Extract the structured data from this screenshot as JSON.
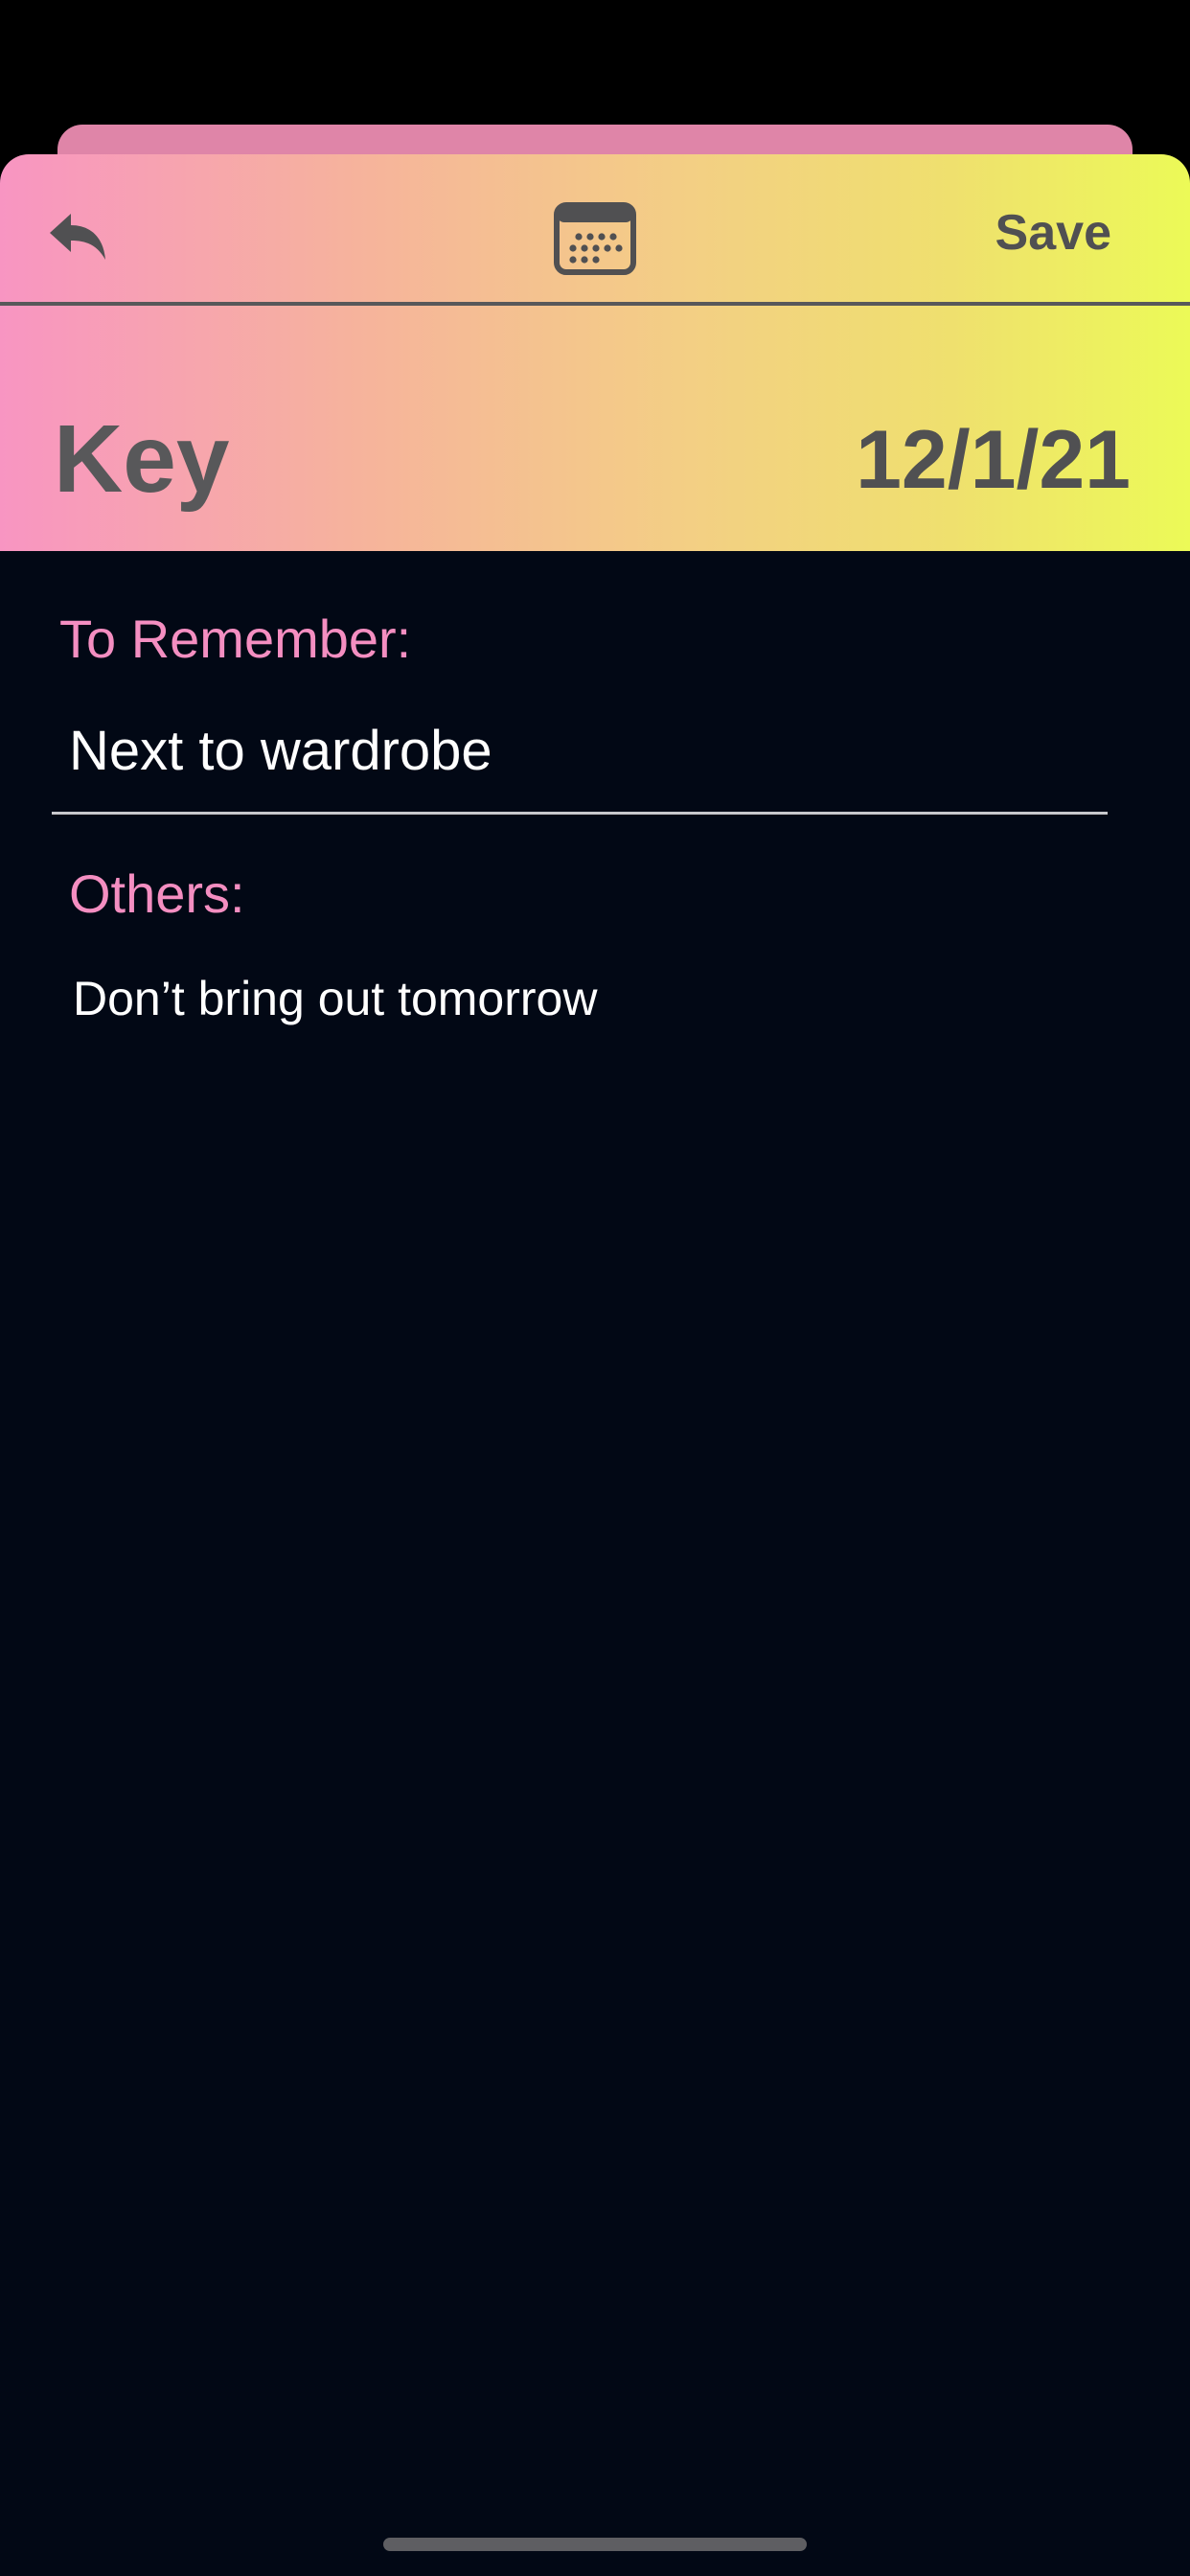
{
  "toolbar": {
    "back_icon": "reply-arrow-icon",
    "calendar_icon": "calendar-icon",
    "save_label": "Save"
  },
  "note": {
    "title": "Key",
    "date": "12/1/21"
  },
  "fields": {
    "remember_label": "To Remember:",
    "remember_value": "Next to wardrobe",
    "others_label": "Others:",
    "others_value": "Don’t bring out tomorrow"
  },
  "colors": {
    "header_gradient": [
      "#f895c2",
      "#f6b39c",
      "#f3cf84",
      "#efe06e",
      "#ecfa57"
    ],
    "label_pink": "#f48ec1",
    "background_dark": "#020815",
    "header_text_gray": "#505052"
  }
}
